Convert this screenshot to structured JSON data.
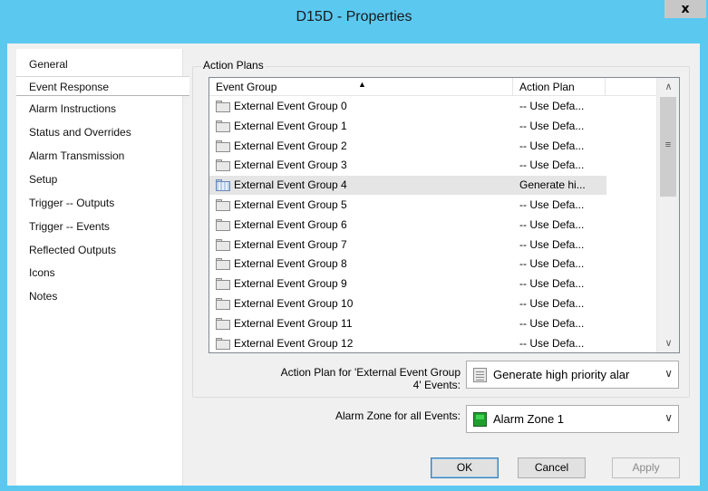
{
  "window": {
    "title": "D15D - Properties",
    "close_glyph": "x"
  },
  "sidebar": {
    "items": [
      {
        "label": "General"
      },
      {
        "label": "Event Response",
        "selected": true
      },
      {
        "label": "Alarm Instructions"
      },
      {
        "label": "Status and Overrides"
      },
      {
        "label": "Alarm Transmission"
      },
      {
        "label": "Setup"
      },
      {
        "label": "Trigger -- Outputs"
      },
      {
        "label": "Trigger -- Events"
      },
      {
        "label": "Reflected Outputs"
      },
      {
        "label": "Icons"
      },
      {
        "label": "Notes"
      }
    ]
  },
  "action_plans": {
    "group_label": "Action Plans",
    "columns": [
      "Event Group",
      "Action Plan"
    ],
    "sort_indicator": "▲",
    "rows": [
      {
        "name": "External Event Group 0",
        "plan": "-- Use Defa..."
      },
      {
        "name": "External Event Group 1",
        "plan": "-- Use Defa..."
      },
      {
        "name": "External Event Group 2",
        "plan": "-- Use Defa..."
      },
      {
        "name": "External Event Group 3",
        "plan": "-- Use Defa..."
      },
      {
        "name": "External Event Group 4",
        "plan": "Generate hi...",
        "selected": true
      },
      {
        "name": "External Event Group 5",
        "plan": "-- Use Defa..."
      },
      {
        "name": "External Event Group 6",
        "plan": "-- Use Defa..."
      },
      {
        "name": "External Event Group 7",
        "plan": "-- Use Defa..."
      },
      {
        "name": "External Event Group 8",
        "plan": "-- Use Defa..."
      },
      {
        "name": "External Event Group 9",
        "plan": "-- Use Defa..."
      },
      {
        "name": "External Event Group 10",
        "plan": "-- Use Defa..."
      },
      {
        "name": "External Event Group 11",
        "plan": "-- Use Defa..."
      },
      {
        "name": "External Event Group 12",
        "plan": "-- Use Defa..."
      }
    ],
    "scroll_up": "∧",
    "scroll_down": "∨",
    "scroll_grip": "≡",
    "plan_label_line1": "Action Plan for 'External Event Group",
    "plan_label_line2": "4' Events:",
    "plan_value": "Generate high priority alar",
    "plan_icon": "document-icon"
  },
  "alarm_zone": {
    "label": "Alarm Zone for all Events:",
    "value": "Alarm Zone 1",
    "icon": "alarm-zone-icon"
  },
  "combo_arrow": "∨",
  "buttons": {
    "ok": "OK",
    "cancel": "Cancel",
    "apply": "Apply"
  },
  "colors": {
    "title_bar": "#5bc8f0",
    "selected_row": "#e5e5e5",
    "zone_green": "#1f9e2c"
  }
}
